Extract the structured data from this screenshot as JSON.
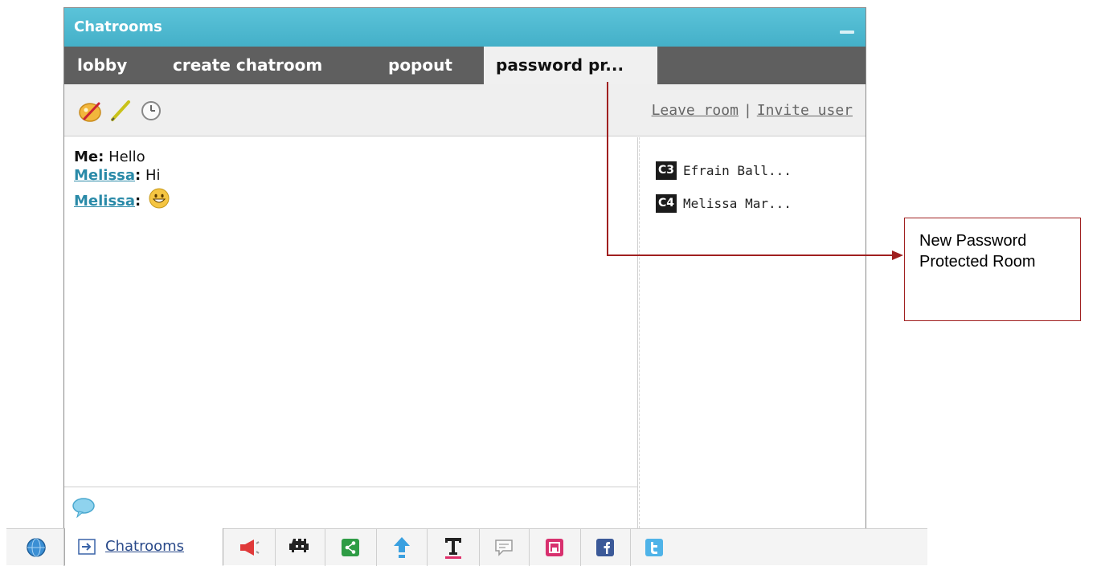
{
  "window": {
    "title": "Chatrooms"
  },
  "tabs": [
    {
      "label": "lobby"
    },
    {
      "label": "create chatroom"
    },
    {
      "label": "popout"
    },
    {
      "label": "password pr..."
    }
  ],
  "toolbar": {
    "leave_room": "Leave room",
    "separator": "|",
    "invite_user": "Invite user"
  },
  "messages": [
    {
      "sender": "Me:",
      "text": "Hello",
      "sender_is_link": false
    },
    {
      "sender": "Melissa",
      "text": "Hi",
      "sender_is_link": true
    },
    {
      "sender": "Melissa",
      "text": "",
      "emoji": "grinning-face",
      "sender_is_link": true
    }
  ],
  "users": [
    {
      "badge": "C3",
      "name": "Efrain Ball..."
    },
    {
      "badge": "C4",
      "name": "Melissa Mar..."
    }
  ],
  "annotation": {
    "text": "New Password Protected Room",
    "color": "#a02020"
  },
  "bottom_bar": {
    "chatrooms_label": "Chatrooms"
  },
  "colors": {
    "titlebar": "#4db8cf",
    "tabbar": "#5f5f5f",
    "link": "#2a8aa8"
  }
}
